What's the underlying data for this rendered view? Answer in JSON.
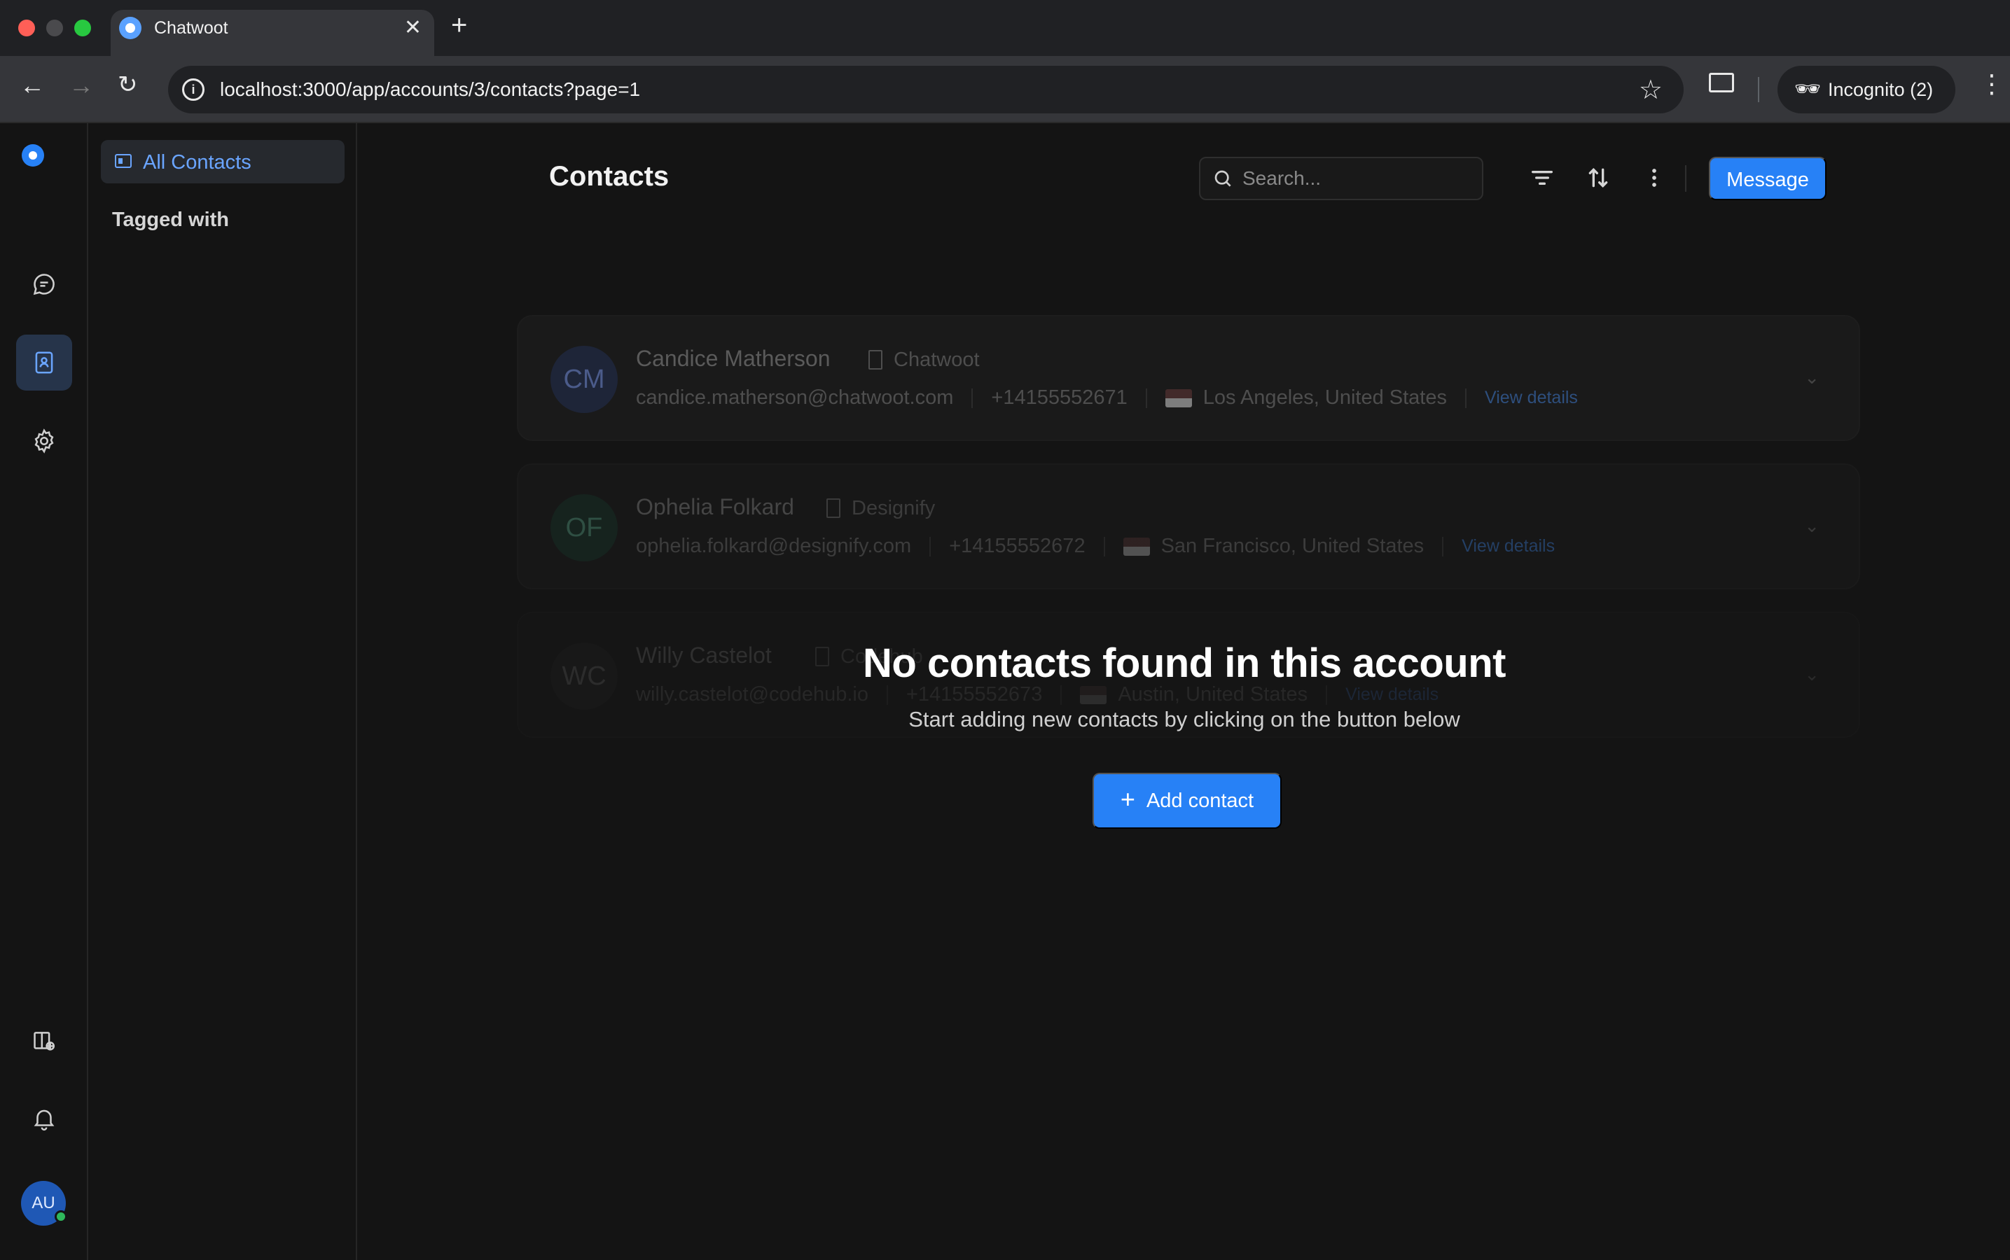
{
  "browser": {
    "tab_title": "Chatwoot",
    "tab_close": "✕",
    "new_tab": "+",
    "url": "localhost:3000/app/accounts/3/contacts?page=1",
    "incognito_label": "Incognito (2)"
  },
  "sidebar": {
    "items": [
      {
        "icon": "chat-bubble-icon",
        "label": "Conversations"
      },
      {
        "icon": "contacts-icon",
        "label": "Contacts",
        "active": true
      },
      {
        "icon": "gear-icon",
        "label": "Settings"
      }
    ],
    "bottom_icons": [
      "help-center-icon",
      "bell-icon"
    ],
    "avatar_initials": "AU"
  },
  "subnav": {
    "active_item": "All Contacts",
    "section_heading": "Tagged with"
  },
  "header": {
    "title": "Contacts",
    "search_placeholder": "Search...",
    "message_button": "Message"
  },
  "ghost_contacts": [
    {
      "initials": "CM",
      "name": "Candice Matherson",
      "company": "Chatwoot",
      "email": "candice.matherson@chatwoot.com",
      "phone": "+14155552671",
      "location": "Los Angeles, United States",
      "link": "View details"
    },
    {
      "initials": "OF",
      "name": "Ophelia Folkard",
      "company": "Designify",
      "email": "ophelia.folkard@designify.com",
      "phone": "+14155552672",
      "location": "San Francisco, United States",
      "link": "View details"
    },
    {
      "initials": "WC",
      "name": "Willy Castelot",
      "company": "Codehub",
      "email": "willy.castelot@codehub.io",
      "phone": "+14155552673",
      "location": "Austin, United States",
      "link": "View details"
    }
  ],
  "empty_state": {
    "title": "No contacts found in this account",
    "subtitle": "Start adding new contacts by clicking on the button below",
    "button_icon": "+",
    "button_label": "Add contact"
  },
  "colors": {
    "accent": "#2781f6",
    "background": "#141414",
    "active_nav": "#26344a"
  }
}
